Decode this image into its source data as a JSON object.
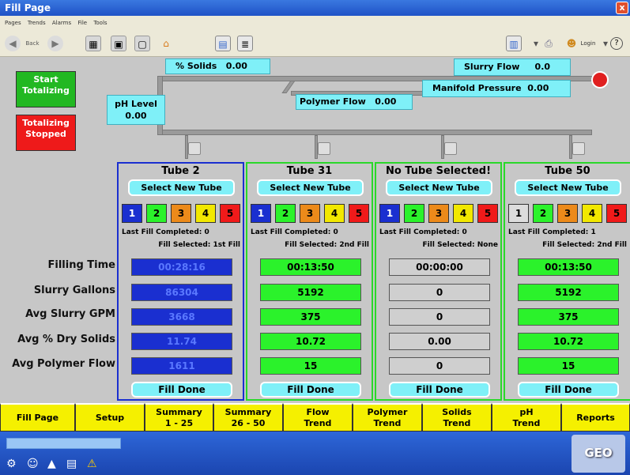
{
  "window": {
    "title": "Fill Page",
    "close_label": "x"
  },
  "menu": [
    "Pages",
    "Trends",
    "Alarms",
    "File",
    "Tools"
  ],
  "toolbar": {
    "back_label": "Back",
    "login_label": "Login",
    "help_label": "?"
  },
  "process": {
    "solids": {
      "label": "% Solids",
      "value": "0.00"
    },
    "slurry_flow": {
      "label": "Slurry Flow",
      "value": "0.0"
    },
    "manifold_pressure": {
      "label": "Manifold Pressure",
      "value": "0.00"
    },
    "polymer_flow": {
      "label": "Polymer Flow",
      "value": "0.00"
    },
    "ph_level": {
      "label": "pH Level",
      "value": "0.00"
    }
  },
  "buttons": {
    "start_totalizing": "Start Totalizing",
    "totalizing_status": "Totalizing Stopped"
  },
  "row_labels": [
    "Filling Time",
    "Slurry Gallons",
    "Avg Slurry GPM",
    "Avg % Dry Solids",
    "Avg Polymer Flow"
  ],
  "colors": {
    "cyan": "#7ff0f8",
    "green": "#2bf22b",
    "blue": "#1a2fd0",
    "gray": "#cfcfcf",
    "yellow": "#f5f000",
    "red": "#f01a1a",
    "orange": "#ec8a1a"
  },
  "tubes": [
    {
      "title": "Tube 2",
      "select_label": "Select New Tube",
      "numbers": [
        "1",
        "2",
        "3",
        "4",
        "5"
      ],
      "last_fill": "Last Fill Completed:   0",
      "fill_selected": "Fill Selected:  1st Fill",
      "values": [
        "00:28:16",
        "86304",
        "3668",
        "11.74",
        "1611"
      ],
      "fill_done": "Fill Done"
    },
    {
      "title": "Tube 31",
      "select_label": "Select New Tube",
      "numbers": [
        "1",
        "2",
        "3",
        "4",
        "5"
      ],
      "last_fill": "Last Fill Completed:   0",
      "fill_selected": "Fill Selected:  2nd Fill",
      "values": [
        "00:13:50",
        "5192",
        "375",
        "10.72",
        "15"
      ],
      "fill_done": "Fill Done"
    },
    {
      "title": "No Tube Selected!",
      "select_label": "Select New Tube",
      "numbers": [
        "1",
        "2",
        "3",
        "4",
        "5"
      ],
      "last_fill": "Last Fill Completed:   0",
      "fill_selected": "Fill Selected:  None",
      "values": [
        "00:00:00",
        "0",
        "0",
        "0.00",
        "0"
      ],
      "fill_done": "Fill Done"
    },
    {
      "title": "Tube 50",
      "select_label": "Select New Tube",
      "numbers": [
        "1",
        "2",
        "3",
        "4",
        "5"
      ],
      "last_fill": "Last Fill Completed:   1",
      "fill_selected": "Fill Selected:  2nd Fill",
      "values": [
        "00:13:50",
        "5192",
        "375",
        "10.72",
        "15"
      ],
      "fill_done": "Fill Done"
    }
  ],
  "nav": [
    {
      "line1": "Fill Page",
      "line2": ""
    },
    {
      "line1": "Setup",
      "line2": ""
    },
    {
      "line1": "Summary",
      "line2": "1 - 25"
    },
    {
      "line1": "Summary",
      "line2": "26 - 50"
    },
    {
      "line1": "Flow",
      "line2": "Trend"
    },
    {
      "line1": "Polymer",
      "line2": "Trend"
    },
    {
      "line1": "Solids",
      "line2": "Trend"
    },
    {
      "line1": "pH",
      "line2": "Trend"
    },
    {
      "line1": "Reports",
      "line2": ""
    }
  ],
  "logo_text": "GEO TUBE"
}
